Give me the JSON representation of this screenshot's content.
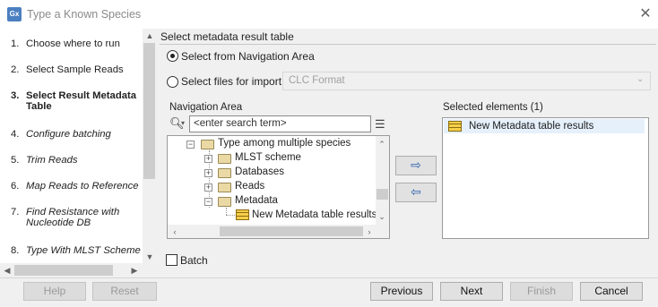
{
  "window": {
    "icon_text": "Gx",
    "title": "Type a Known Species",
    "close_glyph": "✕"
  },
  "steps": [
    {
      "num": "1.",
      "label": "Choose where to run",
      "style": "normal"
    },
    {
      "num": "2.",
      "label": "Select Sample Reads",
      "style": "normal"
    },
    {
      "num": "3.",
      "label": "Select Result Metadata",
      "label2": "Table",
      "style": "current"
    },
    {
      "num": "4.",
      "label": "Configure batching",
      "style": "italic"
    },
    {
      "num": "5.",
      "label": "Trim Reads",
      "style": "italic"
    },
    {
      "num": "6.",
      "label": "Map Reads to Reference",
      "style": "italic"
    },
    {
      "num": "7.",
      "label": "Find Resistance with",
      "label2": "Nucleotide DB",
      "style": "italic"
    },
    {
      "num": "8.",
      "label": "Type With MLST Scheme",
      "style": "italic"
    }
  ],
  "panel": {
    "section_title": "Select metadata result table",
    "radio_navigation": "Select from Navigation Area",
    "radio_files": "Select files for import:",
    "format_value": "CLC Format",
    "navigation_label": "Navigation Area",
    "search_placeholder": "<enter search term>",
    "selected_label": "Selected elements (1)",
    "batch_label": "Batch"
  },
  "tree": [
    {
      "label": "Type among multiple species",
      "type": "folder-open",
      "expander": "−"
    },
    {
      "label": "MLST scheme",
      "type": "folder",
      "expander": "+"
    },
    {
      "label": "Databases",
      "type": "folder",
      "expander": "+"
    },
    {
      "label": "Reads",
      "type": "folder",
      "expander": "+"
    },
    {
      "label": "Metadata",
      "type": "folder-open",
      "expander": "−"
    },
    {
      "label": "New Metadata table results",
      "type": "table"
    }
  ],
  "selected_items": [
    {
      "label": "New Metadata table results",
      "icon": "metadata-table-icon"
    }
  ],
  "buttons": {
    "help": "Help",
    "reset": "Reset",
    "previous": "Previous",
    "next": "Next",
    "finish": "Finish",
    "cancel": "Cancel",
    "add_glyph": "⇨",
    "remove_glyph": "⇦"
  }
}
